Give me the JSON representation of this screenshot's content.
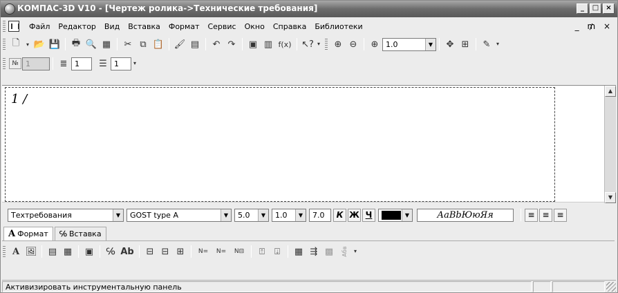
{
  "window": {
    "title": "КОМПАС-3D V10 - [Чертеж ролика->Технические требования]",
    "controls": [
      "_",
      "□",
      "×"
    ]
  },
  "menu": {
    "items": [
      "Файл",
      "Редактор",
      "Вид",
      "Вставка",
      "Формат",
      "Сервис",
      "Окно",
      "Справка",
      "Библиотеки"
    ],
    "mdi_controls": "_ ₥ ×"
  },
  "toolbar_standard": {
    "zoom_value": "1.0",
    "fx_label": "f(x)"
  },
  "toolbar_numbering": {
    "number_icon": "№",
    "number_value": "1",
    "list_value": "1",
    "spacing_value": "1"
  },
  "editor": {
    "text": "1 /"
  },
  "format_panel": {
    "style": "Техтребования",
    "font": "GOST type A",
    "height": "5.0",
    "narrowing": "1.0",
    "step": "7.0",
    "italic_label": "К",
    "bold_label": "Ж",
    "underline_label": "Ч",
    "color": "#000000",
    "preview_text": "АаBbЮюЯя"
  },
  "tabs": {
    "format_label": "Формат",
    "format_icon": "A",
    "insert_label": "Вставка"
  },
  "toolbar_insert": {
    "text_icon": "A",
    "ab_label": "Ab",
    "abc_label": "Абв"
  },
  "status": {
    "message": "Активизировать инструментальную панель"
  }
}
